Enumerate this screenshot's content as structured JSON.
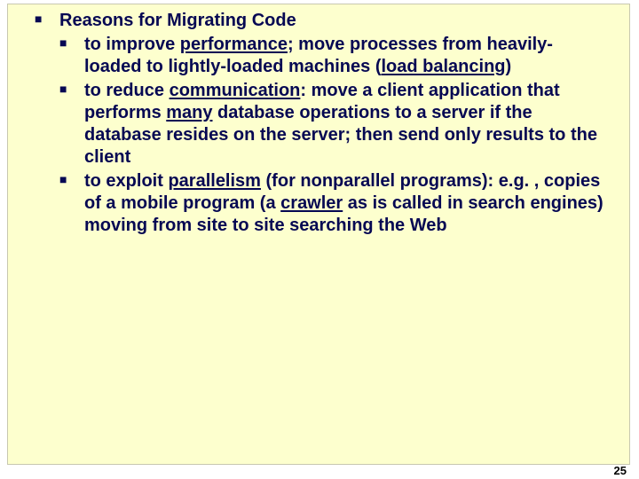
{
  "slide": {
    "items": [
      {
        "level": 1,
        "runs": [
          {
            "text": "Reasons for Migrating Code"
          }
        ]
      },
      {
        "level": 2,
        "runs": [
          {
            "text": "to improve "
          },
          {
            "text": "performance",
            "underline": true
          },
          {
            "text": "; move processes from heavily-loaded to lightly-loaded machines ("
          },
          {
            "text": "load balancing",
            "underline": true
          },
          {
            "text": ")"
          }
        ]
      },
      {
        "level": 2,
        "runs": [
          {
            "text": "to reduce "
          },
          {
            "text": "communication",
            "underline": true
          },
          {
            "text": ": move a client application that performs "
          },
          {
            "text": "many",
            "underline": true
          },
          {
            "text": " database operations to a server if the database resides on the server; then send only results to the client"
          }
        ]
      },
      {
        "level": 2,
        "runs": [
          {
            "text": "to exploit "
          },
          {
            "text": "parallelism",
            "underline": true
          },
          {
            "text": " (for nonparallel programs): e.g. , copies of a mobile program (a "
          },
          {
            "text": "crawler",
            "underline": true
          },
          {
            "text": " as is called in search engines) moving from site to site searching the Web"
          }
        ]
      }
    ],
    "bullet_glyph": "■",
    "page_number": "25"
  }
}
